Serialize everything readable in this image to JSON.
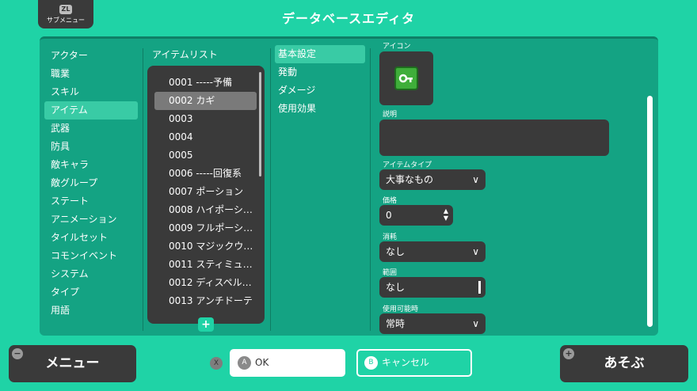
{
  "header": {
    "title": "データベースエディタ",
    "submenu_badge": "ZL",
    "submenu_label": "サブメニュー"
  },
  "categories": [
    {
      "label": "アクター"
    },
    {
      "label": "職業"
    },
    {
      "label": "スキル"
    },
    {
      "label": "アイテム"
    },
    {
      "label": "武器"
    },
    {
      "label": "防具"
    },
    {
      "label": "敵キャラ"
    },
    {
      "label": "敵グループ"
    },
    {
      "label": "ステート"
    },
    {
      "label": "アニメーション"
    },
    {
      "label": "タイルセット"
    },
    {
      "label": "コモンイベント"
    },
    {
      "label": "システム"
    },
    {
      "label": "タイプ"
    },
    {
      "label": "用語"
    }
  ],
  "selected_category": "アイテム",
  "item_list": {
    "header": "アイテムリスト",
    "items": [
      {
        "label": "0001 -----予備"
      },
      {
        "label": "0002 カギ"
      },
      {
        "label": "0003"
      },
      {
        "label": "0004"
      },
      {
        "label": "0005"
      },
      {
        "label": "0006 -----回復系"
      },
      {
        "label": "0007 ポーション"
      },
      {
        "label": "0008 ハイポーシ…"
      },
      {
        "label": "0009 フルポーシ…"
      },
      {
        "label": "0010 マジックウ…"
      },
      {
        "label": "0011 スティミュ…"
      },
      {
        "label": "0012 ディスペル…"
      },
      {
        "label": "0013 アンチドーテ"
      }
    ],
    "selected": "0002 カギ",
    "add_label": "+"
  },
  "tabs": [
    {
      "label": "基本設定"
    },
    {
      "label": "発動"
    },
    {
      "label": "ダメージ"
    },
    {
      "label": "使用効果"
    }
  ],
  "selected_tab": "基本設定",
  "form": {
    "icon_label": "アイコン",
    "icon_name": "key-icon",
    "description_label": "説明",
    "description_value": "",
    "item_type_label": "アイテムタイプ",
    "item_type_value": "大事なもの",
    "price_label": "価格",
    "price_value": "0",
    "consume_label": "消耗",
    "consume_value": "なし",
    "scope_label": "範囲",
    "scope_value": "なし",
    "occasion_label": "使用可能時",
    "occasion_value": "常時"
  },
  "bottom": {
    "menu_label": "メニュー",
    "menu_badge": "−",
    "x_badge": "X",
    "ok_badge": "A",
    "ok_label": "OK",
    "cancel_badge": "B",
    "cancel_label": "キャンセル",
    "play_badge": "+",
    "play_label": "あそぶ"
  },
  "colors": {
    "background": "#1fd3a6",
    "panel": "#14a383",
    "dark_control": "#3a3a3a",
    "highlight": "#39cba5"
  }
}
